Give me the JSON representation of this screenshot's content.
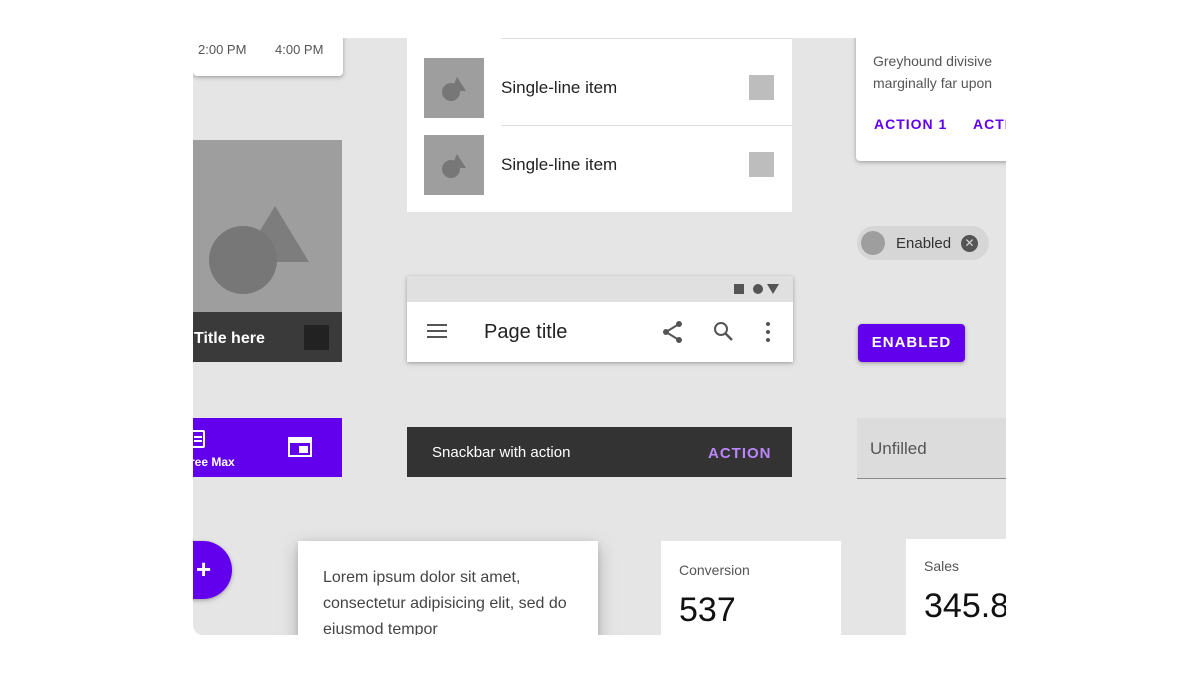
{
  "time_picker": {
    "times": [
      "2:00 PM",
      "4:00 PM"
    ]
  },
  "list": {
    "items": [
      {
        "label": "Single-line item"
      },
      {
        "label": "Single-line item"
      }
    ]
  },
  "media_card": {
    "title": "Title here"
  },
  "app_bar": {
    "title": "Page title",
    "icons": [
      "menu-icon",
      "share-icon",
      "search-icon",
      "more-vert-icon"
    ],
    "status_icons": [
      "square-icon",
      "circle-icon",
      "triangle-icon"
    ]
  },
  "text_card": {
    "body_lines": [
      "Greyhound divisive",
      "marginally far upon"
    ],
    "actions": [
      "ACTION 1",
      "ACTI"
    ]
  },
  "chip": {
    "label": "Enabled"
  },
  "button": {
    "label": "ENABLED"
  },
  "text_field": {
    "placeholder": "Unfilled"
  },
  "bottom_nav": {
    "label": "ree Max"
  },
  "snackbar": {
    "message": "Snackbar with action",
    "action": "ACTION"
  },
  "fab": {
    "glyph": "+"
  },
  "lorem_card": {
    "text": "Lorem ipsum dolor sit amet, consectetur adipisicing elit, sed do eiusmod tempor"
  },
  "stats": [
    {
      "label": "Conversion",
      "value": "537"
    },
    {
      "label": "Sales",
      "value": "345.8"
    }
  ],
  "colors": {
    "primary": "#6200ee",
    "surface": "#ffffff",
    "board": "#e5e5e5",
    "snackbar": "#333333",
    "snackbar_action": "#bb86fc"
  }
}
